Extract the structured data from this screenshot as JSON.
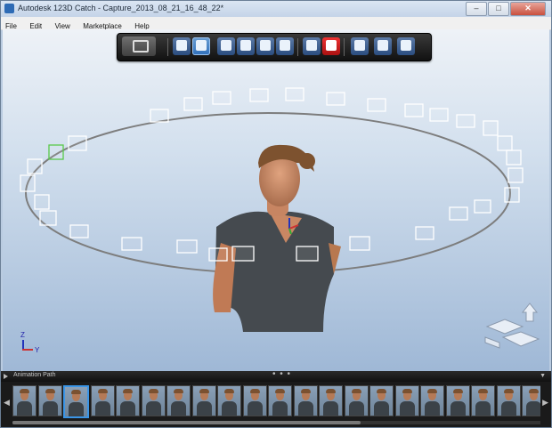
{
  "window": {
    "title": "Autodesk 123D Catch - Capture_2013_08_21_16_48_22*",
    "buttons": {
      "minimize": "–",
      "maximize": "□",
      "close": "✕"
    }
  },
  "menubar": {
    "items": [
      "File",
      "Edit",
      "View",
      "Marketplace",
      "Help"
    ]
  },
  "toolbar": {
    "tools": [
      "camera-capture-icon",
      "select-arrow-icon",
      "select-arrow-active-icon",
      "pan-hand-icon",
      "camera-frame-icon",
      "orbit-icon",
      "camera-lock-icon",
      "measure-ruler-icon",
      "youtube-icon",
      "pen-tool-icon",
      "export-cube-icon",
      "document-icon"
    ],
    "youtube_label": "You Tube"
  },
  "viewport": {
    "axis_labels": {
      "z": "Z",
      "y": "Y"
    }
  },
  "animation_path": {
    "label": "Animation Path",
    "handle": "• • •",
    "collapse": "▼"
  },
  "filmstrip": {
    "selected_index": 2,
    "thumb_count": 22,
    "scroll_fraction": 0.66
  }
}
